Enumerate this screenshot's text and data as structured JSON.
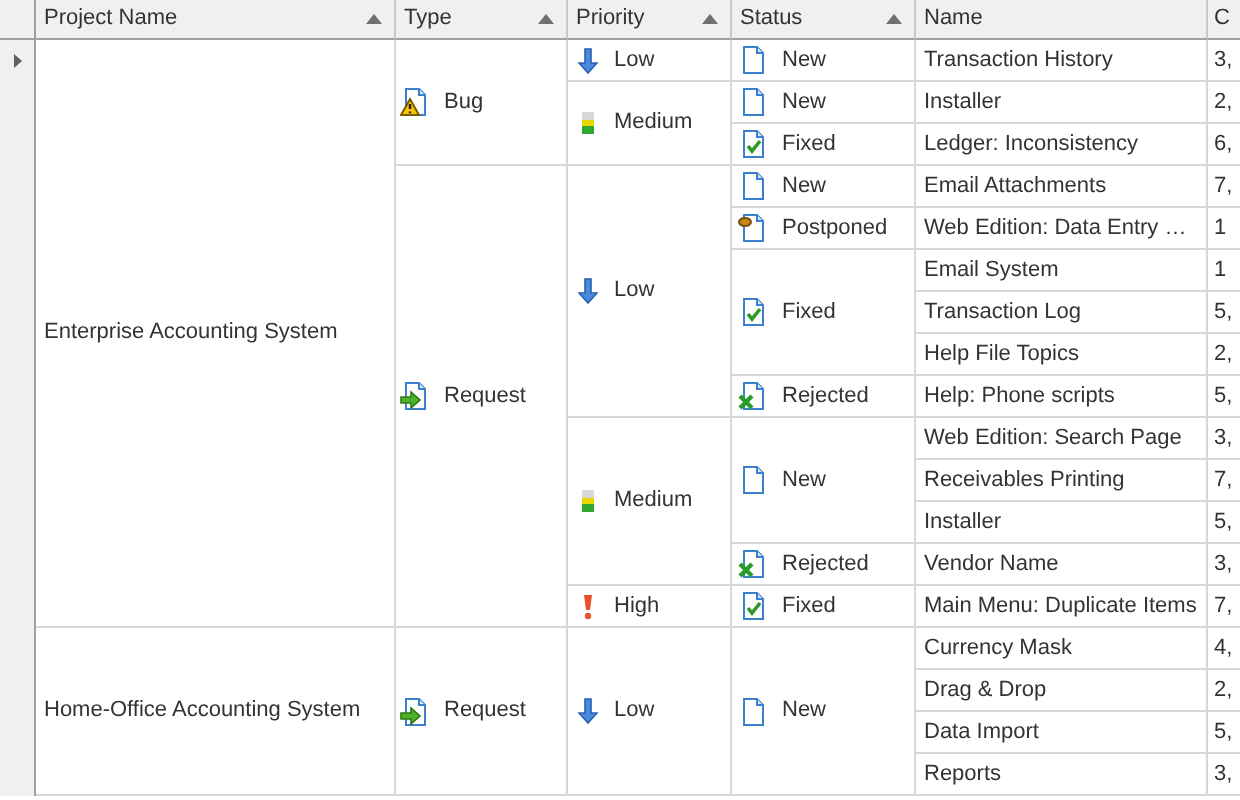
{
  "columns": [
    {
      "label": "Project Name",
      "sorted": true
    },
    {
      "label": "Type",
      "sorted": true
    },
    {
      "label": "Priority",
      "sorted": true
    },
    {
      "label": "Status",
      "sorted": true
    },
    {
      "label": "Name",
      "sorted": false
    },
    {
      "label": "C",
      "sorted": false
    }
  ],
  "projects": [
    {
      "name": "Enterprise Accounting System",
      "types": [
        {
          "name": "Bug",
          "kind": "bug",
          "priorities": [
            {
              "name": "Low",
              "kind": "low",
              "statuses": [
                {
                  "name": "New",
                  "kind": "new",
                  "tasks": [
                    {
                      "name": "Transaction History",
                      "column_6": "3,",
                      "current": true
                    }
                  ]
                }
              ]
            },
            {
              "name": "Medium",
              "kind": "medium",
              "statuses": [
                {
                  "name": "New",
                  "kind": "new",
                  "tasks": [
                    {
                      "name": "Installer",
                      "column_6": "2,",
                      "current": false
                    }
                  ]
                },
                {
                  "name": "Fixed",
                  "kind": "fixed",
                  "tasks": [
                    {
                      "name": "Ledger: Inconsistency",
                      "column_6": "6,",
                      "current": false
                    }
                  ]
                }
              ]
            }
          ]
        },
        {
          "name": "Request",
          "kind": "request",
          "priorities": [
            {
              "name": "Low",
              "kind": "low",
              "statuses": [
                {
                  "name": "New",
                  "kind": "new",
                  "tasks": [
                    {
                      "name": "Email Attachments",
                      "column_6": "7,",
                      "current": false
                    }
                  ]
                },
                {
                  "name": "Postponed",
                  "kind": "postponed",
                  "tasks": [
                    {
                      "name": "Web Edition: Data Entry …",
                      "column_6": "1",
                      "current": false
                    }
                  ]
                },
                {
                  "name": "Fixed",
                  "kind": "fixed",
                  "tasks": [
                    {
                      "name": "Email System",
                      "column_6": "1",
                      "current": false
                    },
                    {
                      "name": "Transaction Log",
                      "column_6": "5,",
                      "current": false
                    },
                    {
                      "name": "Help File Topics",
                      "column_6": "2,",
                      "current": false
                    }
                  ]
                },
                {
                  "name": "Rejected",
                  "kind": "rejected",
                  "tasks": [
                    {
                      "name": "Help: Phone scripts",
                      "column_6": "5,",
                      "current": false
                    }
                  ]
                }
              ]
            },
            {
              "name": "Medium",
              "kind": "medium",
              "statuses": [
                {
                  "name": "New",
                  "kind": "new",
                  "tasks": [
                    {
                      "name": "Web Edition: Search Page",
                      "column_6": "3,",
                      "current": false
                    },
                    {
                      "name": "Receivables Printing",
                      "column_6": "7,",
                      "current": false
                    },
                    {
                      "name": "Installer",
                      "column_6": "5,",
                      "current": false
                    }
                  ]
                },
                {
                  "name": "Rejected",
                  "kind": "rejected",
                  "tasks": [
                    {
                      "name": "Vendor Name",
                      "column_6": "3,",
                      "current": false
                    }
                  ]
                }
              ]
            },
            {
              "name": "High",
              "kind": "high",
              "statuses": [
                {
                  "name": "Fixed",
                  "kind": "fixed",
                  "tasks": [
                    {
                      "name": "Main Menu: Duplicate Items",
                      "column_6": "7,",
                      "current": false
                    }
                  ]
                }
              ]
            }
          ]
        }
      ]
    },
    {
      "name": "Home-Office Accounting System",
      "types": [
        {
          "name": "Request",
          "kind": "request",
          "priorities": [
            {
              "name": "Low",
              "kind": "low",
              "statuses": [
                {
                  "name": "New",
                  "kind": "new",
                  "tasks": [
                    {
                      "name": "Currency Mask",
                      "column_6": "4,",
                      "current": false
                    },
                    {
                      "name": "Drag & Drop",
                      "column_6": "2,",
                      "current": false
                    },
                    {
                      "name": "Data Import",
                      "column_6": "5,",
                      "current": false
                    },
                    {
                      "name": "Reports",
                      "column_6": "3,",
                      "current": false
                    }
                  ]
                }
              ]
            }
          ]
        }
      ]
    }
  ]
}
